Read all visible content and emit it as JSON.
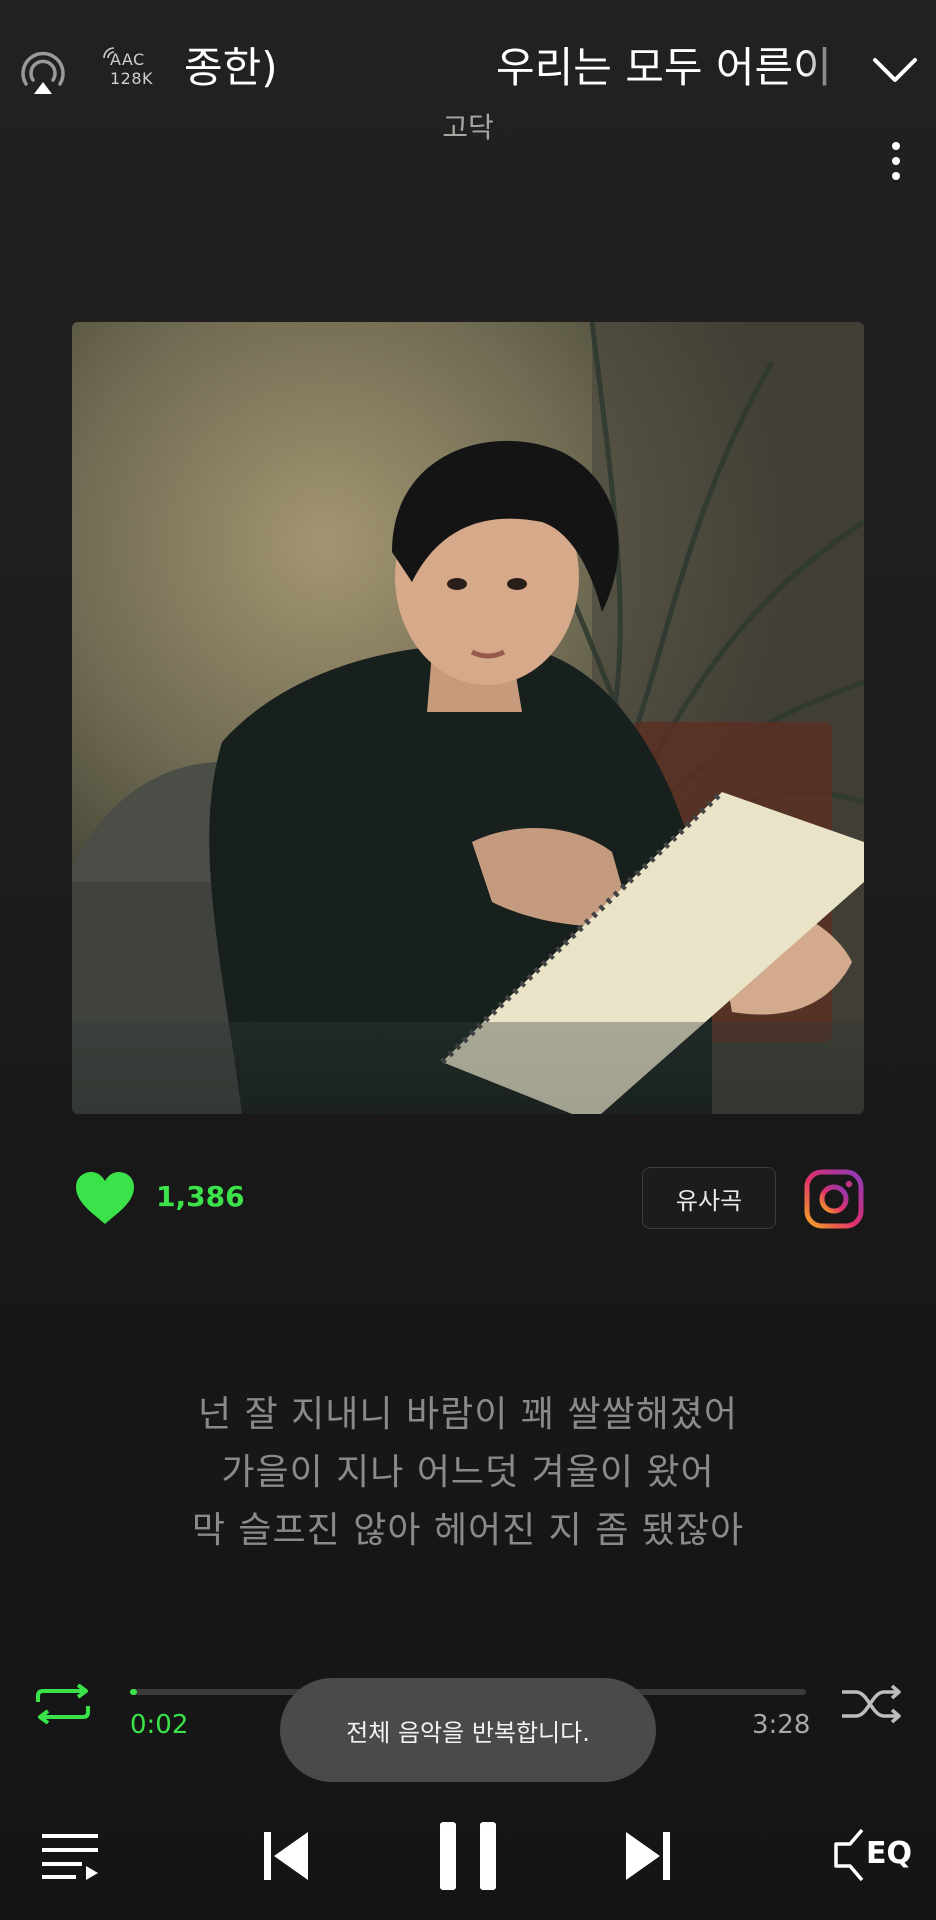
{
  "header": {
    "codec_line1": "AAC",
    "codec_line2": "128K",
    "title_left": "종한)",
    "title_right": "우리는 모두 어른이",
    "artist": "고닥"
  },
  "actions": {
    "like_count": "1,386",
    "similar_label": "유사곡"
  },
  "lyrics": [
    "넌 잘 지내니 바람이 꽤 쌀쌀해졌어",
    "가을이 지나 어느덧 겨울이 왔어",
    "막 슬프진 않아 헤어진 지 좀 됐잖아"
  ],
  "player": {
    "elapsed": "0:02",
    "total": "3:28",
    "progress_fraction": 0.01,
    "repeat_mode": "all",
    "accent_color": "#3be24a",
    "eq_label": "EQ"
  },
  "toast": {
    "message": "전체 음악을 반복합니다."
  },
  "icons": {
    "cast": "cast-icon",
    "codec": "wireless-codec-icon",
    "collapse": "chevron-down-icon",
    "more": "more-vertical-icon",
    "like": "heart-icon",
    "instagram": "instagram-icon",
    "repeat": "repeat-icon",
    "shuffle": "shuffle-icon",
    "playlist": "playlist-icon",
    "previous": "skip-previous-icon",
    "pause": "pause-icon",
    "next": "skip-next-icon",
    "eq": "equalizer-icon"
  }
}
